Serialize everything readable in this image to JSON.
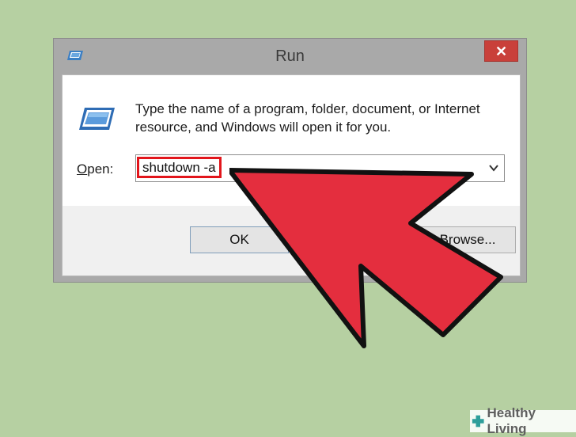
{
  "window": {
    "title": "Run",
    "close_glyph": "✕",
    "description": "Type the name of a program, folder, document, or Internet resource, and Windows will open it for you.",
    "open_label_accesskey": "O",
    "open_label_rest": "pen:",
    "open_value": "shutdown -a",
    "ok_label": "OK",
    "browse_label": "Browse..."
  },
  "icons": {
    "app": "run-app-icon",
    "dropdown": "chevron-down-icon",
    "close": "close-icon"
  },
  "branding": {
    "text": "Healthy Living"
  },
  "colors": {
    "background": "#b6d0a2",
    "arrow": "#e42e3e",
    "highlight_box": "#e2151b",
    "close_button": "#c9403a"
  }
}
